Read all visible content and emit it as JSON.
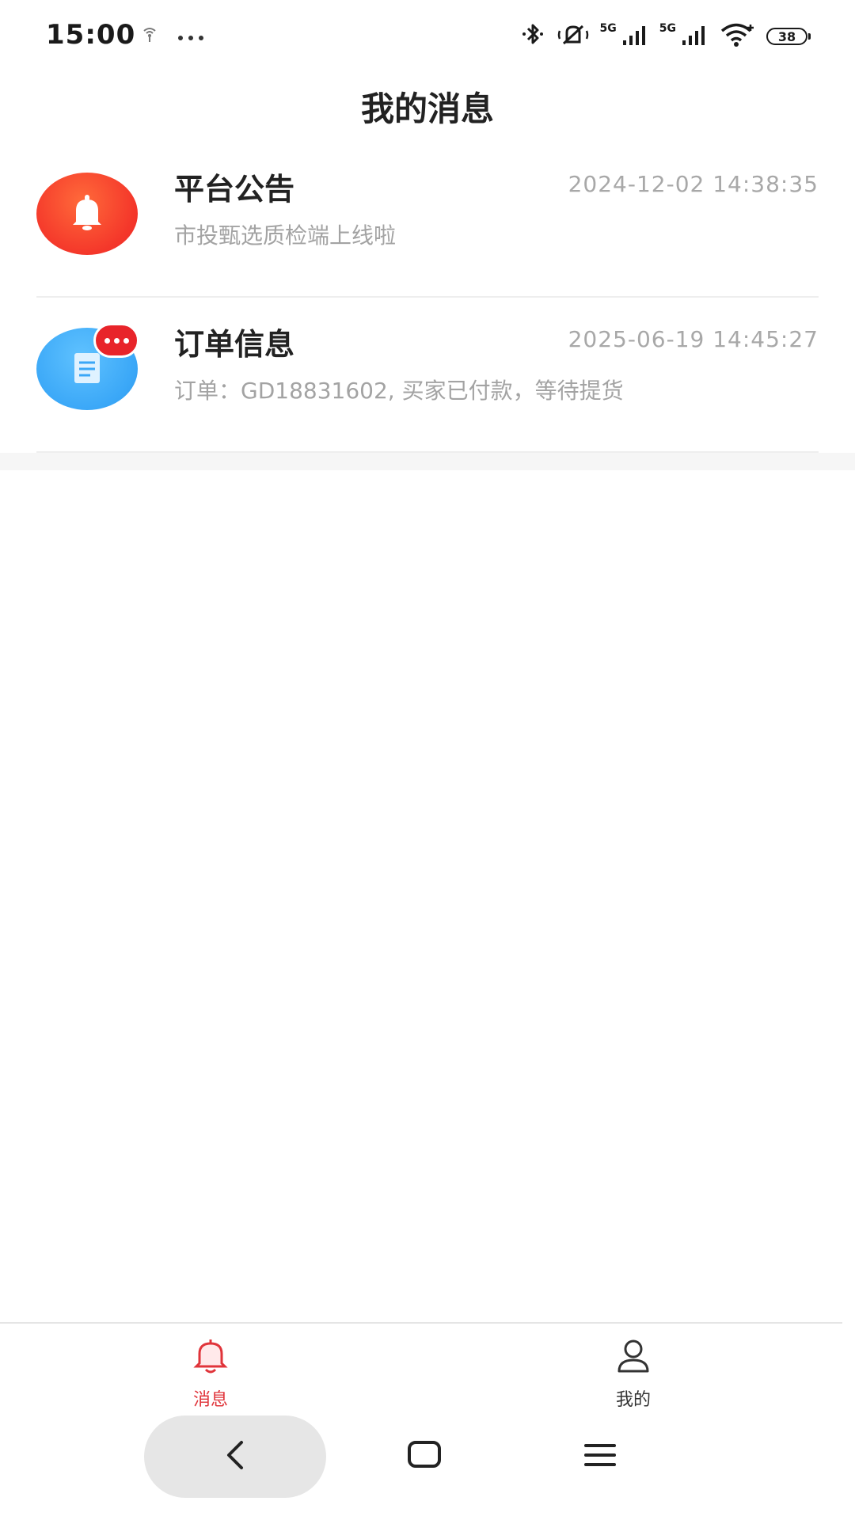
{
  "status_bar": {
    "time": "15:00",
    "network_1": "5G",
    "network_2": "5G",
    "battery": "38",
    "icons": [
      "hotspot-icon",
      "more-dots-icon",
      "bluetooth-icon",
      "mute-icon",
      "signal-icon",
      "signal-icon",
      "wifi-icon",
      "battery-icon"
    ]
  },
  "header": {
    "title": "我的消息"
  },
  "messages": [
    {
      "title": "平台公告",
      "time": "2024-12-02 14:38:35",
      "preview": "市投甄选质检端上线啦",
      "icon": "bell-icon",
      "color": "#f4362a"
    },
    {
      "title": "订单信息",
      "time": "2025-06-19 14:45:27",
      "preview": "订单：GD18831602, 买家已付款，等待提货",
      "icon": "document-icon",
      "color": "#3aa7f7",
      "has_badge": true
    }
  ],
  "tab_bar": {
    "tabs": [
      {
        "label": "消息",
        "icon": "bell-outline-icon",
        "active": true
      },
      {
        "label": "我的",
        "icon": "user-icon",
        "active": false
      }
    ],
    "active_color": "#e0343a",
    "inactive_color": "#333333"
  },
  "system_nav": {
    "buttons": [
      "back-icon",
      "home-icon",
      "menu-icon"
    ]
  }
}
